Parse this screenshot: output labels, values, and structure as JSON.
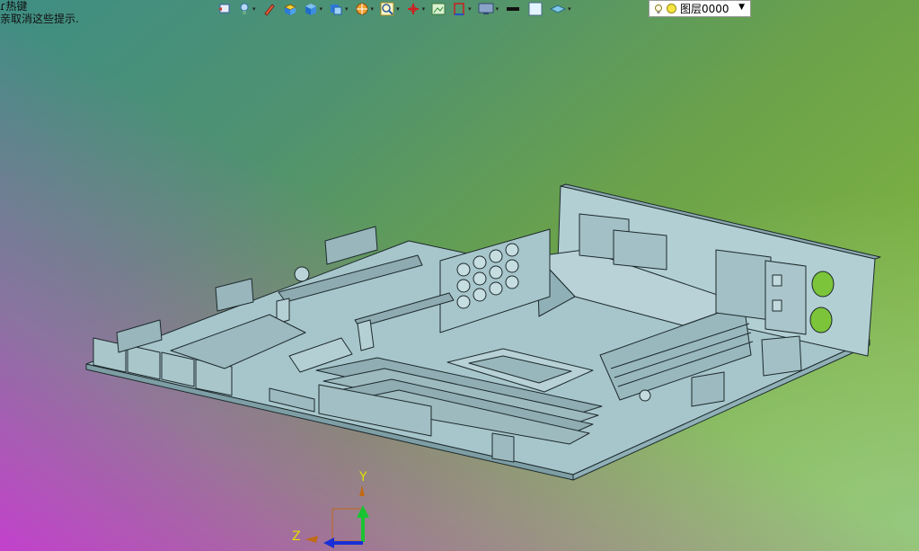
{
  "prompt": {
    "line1": "ɾ热键",
    "line2": "亲取消这些提示."
  },
  "toolbar": {
    "buttons": [
      {
        "icon": "view-fit-icon",
        "dropdown": false
      },
      {
        "icon": "light-icon",
        "dropdown": true
      },
      {
        "icon": "pencil-icon",
        "dropdown": false
      },
      {
        "icon": "box-icon",
        "dropdown": false
      },
      {
        "icon": "cube-icon",
        "dropdown": true
      },
      {
        "icon": "view-cube-icon",
        "dropdown": true
      },
      {
        "icon": "sphere-section-icon",
        "dropdown": true
      },
      {
        "icon": "zoom-icon",
        "dropdown": true
      },
      {
        "icon": "pin-icon",
        "dropdown": true
      },
      {
        "icon": "image-icon",
        "dropdown": false
      },
      {
        "icon": "frame-icon",
        "dropdown": true
      },
      {
        "icon": "monitor-icon",
        "dropdown": true
      },
      {
        "icon": "line-icon",
        "dropdown": false
      },
      {
        "icon": "square-icon",
        "dropdown": false
      },
      {
        "icon": "layer-icon",
        "dropdown": true
      }
    ],
    "layer": {
      "name": "图层0000"
    }
  },
  "axes": {
    "y_label": "Y",
    "z_label": "Z"
  },
  "colors": {
    "model": "#a7c6cc",
    "edge": "#1d2a2c",
    "hole": "#7cc43a",
    "axis_y": "#19c431",
    "axis_x": "#1a2fd6",
    "axis_z": "#c06a16"
  }
}
